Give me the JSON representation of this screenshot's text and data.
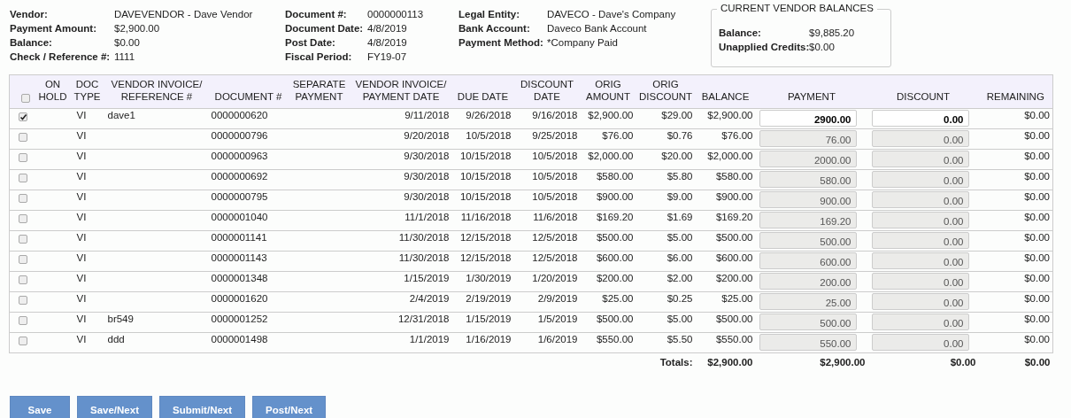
{
  "summary": [
    [
      {
        "label": "Vendor:",
        "value": "DAVEVENDOR - Dave Vendor"
      },
      {
        "label": "Payment Amount:",
        "value": "$2,900.00"
      },
      {
        "label": "Balance:",
        "value": "$0.00"
      },
      {
        "label": "Check / Reference #:",
        "value": "1111"
      }
    ],
    [
      {
        "label": "Document #:",
        "value": "0000000113"
      },
      {
        "label": "Document Date:",
        "value": "4/8/2019"
      },
      {
        "label": "Post Date:",
        "value": "4/8/2019"
      },
      {
        "label": "Fiscal Period:",
        "value": "FY19-07"
      }
    ],
    [
      {
        "label": "Legal Entity:",
        "value": "DAVECO - Dave's Company"
      },
      {
        "label": "Bank Account:",
        "value": "Daveco Bank Account"
      },
      {
        "label": "Payment Method:",
        "value": "*Company Paid"
      }
    ]
  ],
  "vendor_balances": {
    "title": "CURRENT VENDOR BALANCES",
    "items": [
      {
        "label": "Balance:",
        "value": "$9,885.20"
      },
      {
        "label": "Unapplied Credits:",
        "value": "$0.00"
      }
    ]
  },
  "table": {
    "select_all_checked": false,
    "columns": [
      "ON HOLD",
      "DOC TYPE",
      "VENDOR INVOICE/ REFERENCE #",
      "DOCUMENT #",
      "SEPARATE PAYMENT",
      "VENDOR INVOICE/ PAYMENT DATE",
      "DUE DATE",
      "DISCOUNT DATE",
      "ORIG AMOUNT",
      "ORIG DISCOUNT",
      "BALANCE",
      "PAYMENT",
      "DISCOUNT",
      "REMAINING"
    ],
    "rows": [
      {
        "checked": true,
        "doc_type": "VI",
        "reference": "dave1",
        "document": "0000000620",
        "invoice_date": "9/11/2018",
        "due_date": "9/26/2018",
        "discount_date": "9/16/2018",
        "orig_amount": "$2,900.00",
        "orig_discount": "$29.00",
        "balance": "$2,900.00",
        "payment": "2900.00",
        "discount": "0.00",
        "remaining": "$0.00"
      },
      {
        "checked": false,
        "doc_type": "VI",
        "document": "0000000796",
        "invoice_date": "9/20/2018",
        "due_date": "10/5/2018",
        "discount_date": "9/25/2018",
        "orig_amount": "$76.00",
        "orig_discount": "$0.76",
        "balance": "$76.00",
        "payment": "76.00",
        "discount": "0.00",
        "remaining": "$0.00"
      },
      {
        "checked": false,
        "doc_type": "VI",
        "document": "0000000963",
        "invoice_date": "9/30/2018",
        "due_date": "10/15/2018",
        "discount_date": "10/5/2018",
        "orig_amount": "$2,000.00",
        "orig_discount": "$20.00",
        "balance": "$2,000.00",
        "payment": "2000.00",
        "discount": "0.00",
        "remaining": "$0.00"
      },
      {
        "checked": false,
        "doc_type": "VI",
        "document": "0000000692",
        "invoice_date": "9/30/2018",
        "due_date": "10/15/2018",
        "discount_date": "10/5/2018",
        "orig_amount": "$580.00",
        "orig_discount": "$5.80",
        "balance": "$580.00",
        "payment": "580.00",
        "discount": "0.00",
        "remaining": "$0.00"
      },
      {
        "checked": false,
        "doc_type": "VI",
        "document": "0000000795",
        "invoice_date": "9/30/2018",
        "due_date": "10/15/2018",
        "discount_date": "10/5/2018",
        "orig_amount": "$900.00",
        "orig_discount": "$9.00",
        "balance": "$900.00",
        "payment": "900.00",
        "discount": "0.00",
        "remaining": "$0.00"
      },
      {
        "checked": false,
        "doc_type": "VI",
        "document": "0000001040",
        "invoice_date": "11/1/2018",
        "due_date": "11/16/2018",
        "discount_date": "11/6/2018",
        "orig_amount": "$169.20",
        "orig_discount": "$1.69",
        "balance": "$169.20",
        "payment": "169.20",
        "discount": "0.00",
        "remaining": "$0.00"
      },
      {
        "checked": false,
        "doc_type": "VI",
        "document": "0000001141",
        "invoice_date": "11/30/2018",
        "due_date": "12/15/2018",
        "discount_date": "12/5/2018",
        "orig_amount": "$500.00",
        "orig_discount": "$5.00",
        "balance": "$500.00",
        "payment": "500.00",
        "discount": "0.00",
        "remaining": "$0.00"
      },
      {
        "checked": false,
        "doc_type": "VI",
        "document": "0000001143",
        "invoice_date": "11/30/2018",
        "due_date": "12/15/2018",
        "discount_date": "12/5/2018",
        "orig_amount": "$600.00",
        "orig_discount": "$6.00",
        "balance": "$600.00",
        "payment": "600.00",
        "discount": "0.00",
        "remaining": "$0.00"
      },
      {
        "checked": false,
        "doc_type": "VI",
        "document": "0000001348",
        "invoice_date": "1/15/2019",
        "due_date": "1/30/2019",
        "discount_date": "1/20/2019",
        "orig_amount": "$200.00",
        "orig_discount": "$2.00",
        "balance": "$200.00",
        "payment": "200.00",
        "discount": "0.00",
        "remaining": "$0.00"
      },
      {
        "checked": false,
        "doc_type": "VI",
        "document": "0000001620",
        "invoice_date": "2/4/2019",
        "due_date": "2/19/2019",
        "discount_date": "2/9/2019",
        "orig_amount": "$25.00",
        "orig_discount": "$0.25",
        "balance": "$25.00",
        "payment": "25.00",
        "discount": "0.00",
        "remaining": "$0.00"
      },
      {
        "checked": false,
        "doc_type": "VI",
        "reference": "br549",
        "document": "0000001252",
        "invoice_date": "12/31/2018",
        "due_date": "1/15/2019",
        "discount_date": "1/5/2019",
        "orig_amount": "$500.00",
        "orig_discount": "$5.00",
        "balance": "$500.00",
        "payment": "500.00",
        "discount": "0.00",
        "remaining": "$0.00"
      },
      {
        "checked": false,
        "doc_type": "VI",
        "reference": "ddd",
        "document": "0000001498",
        "invoice_date": "1/1/2019",
        "due_date": "1/16/2019",
        "discount_date": "1/6/2019",
        "orig_amount": "$550.00",
        "orig_discount": "$5.50",
        "balance": "$550.00",
        "payment": "550.00",
        "discount": "0.00",
        "remaining": "$0.00"
      }
    ],
    "totals": {
      "label": "Totals:",
      "balance": "$2,900.00",
      "payment": "$2,900.00",
      "discount": "$0.00",
      "remaining": "$0.00"
    }
  },
  "buttons": [
    "Save",
    "Save/Next",
    "Submit/Next",
    "Post/Next"
  ]
}
